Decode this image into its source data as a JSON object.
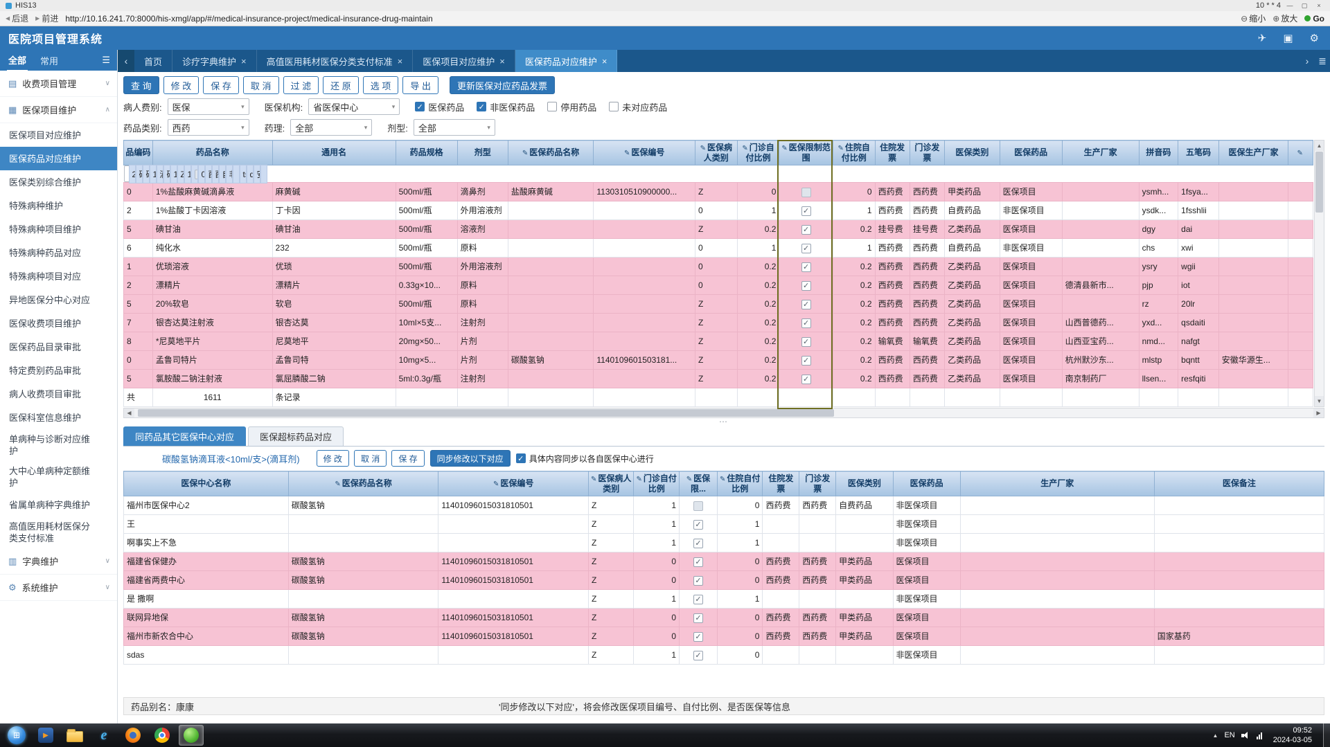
{
  "chrome": {
    "window_title": "HIS13",
    "window_meta": "10 * * 4",
    "back": "后退",
    "forward": "前进",
    "url": "http://10.16.241.70:8000/his-xmgl/app/#/medical-insurance-project/medical-insurance-drug-maintain",
    "zoom_out": "缩小",
    "zoom_in": "放大",
    "go": "Go"
  },
  "app": {
    "title": "医院项目管理系统",
    "header_icons": [
      "plane-icon",
      "window-copy-icon",
      "gear-icon"
    ]
  },
  "colors": {
    "accent": "#2e75b6",
    "pink_row": "#f7c3d4",
    "selected_row": "#cddcf2",
    "highlight_box": "#6f6f22"
  },
  "sidebar": {
    "tabs": [
      "全部",
      "常用"
    ],
    "menu": [
      {
        "type": "group",
        "label": "收费项目管理",
        "icon": "form-icon",
        "expanded": false
      },
      {
        "type": "group",
        "label": "医保项目维护",
        "icon": "board-icon",
        "expanded": true
      },
      {
        "type": "item",
        "label": "医保项目对应维护"
      },
      {
        "type": "item",
        "label": "医保药品对应维护",
        "active": true
      },
      {
        "type": "item",
        "label": "医保类别综合维护"
      },
      {
        "type": "item",
        "label": "特殊病种维护"
      },
      {
        "type": "item",
        "label": "特殊病种项目维护"
      },
      {
        "type": "item",
        "label": "特殊病种药品对应"
      },
      {
        "type": "item",
        "label": "特殊病种项目对应"
      },
      {
        "type": "item",
        "label": "异地医保分中心对应"
      },
      {
        "type": "item",
        "label": "医保收费项目维护"
      },
      {
        "type": "item",
        "label": "医保药品目录审批"
      },
      {
        "type": "item",
        "label": "特定费别药品审批"
      },
      {
        "type": "item",
        "label": "病人收费项目审批"
      },
      {
        "type": "item",
        "label": "医保科室信息维护"
      },
      {
        "type": "item",
        "label": "单病种与诊断对应维护"
      },
      {
        "type": "item",
        "label": "大中心单病种定额维护"
      },
      {
        "type": "item",
        "label": "省属单病种字典维护"
      },
      {
        "type": "item",
        "label": "高值医用耗材医保分类支付标准"
      },
      {
        "type": "group",
        "label": "字典维护",
        "icon": "dict-icon",
        "expanded": false
      },
      {
        "type": "group",
        "label": "系统维护",
        "icon": "gear-icon",
        "expanded": false
      }
    ]
  },
  "tabstrip": {
    "tabs": [
      {
        "label": "首页",
        "closable": false,
        "active": false
      },
      {
        "label": "诊疗字典维护",
        "closable": true,
        "active": false
      },
      {
        "label": "高值医用耗材医保分类支付标准",
        "closable": true,
        "active": false
      },
      {
        "label": "医保项目对应维护",
        "closable": true,
        "active": false
      },
      {
        "label": "医保药品对应维护",
        "closable": true,
        "active": true
      }
    ]
  },
  "toolbar": {
    "buttons": [
      "查 询",
      "修 改",
      "保 存",
      "取 消",
      "过 滤",
      "还 原",
      "选 项",
      "导 出"
    ],
    "update_button": "更新医保对应药品发票"
  },
  "filters": {
    "patient_fee_label": "病人费别:",
    "patient_fee_value": "医保",
    "org_label": "医保机构:",
    "org_value": "省医保中心",
    "checkboxes": [
      {
        "label": "医保药品",
        "checked": true
      },
      {
        "label": "非医保药品",
        "checked": true
      },
      {
        "label": "停用药品",
        "checked": false
      },
      {
        "label": "未对应药品",
        "checked": false
      }
    ],
    "drug_class_label": "药品类别:",
    "drug_class_value": "西药",
    "pharm_label": "药理:",
    "pharm_value": "全部",
    "dosage_label": "剂型:",
    "dosage_value": "全部"
  },
  "main_table": {
    "columns": [
      {
        "label": "品编码",
        "a": "l"
      },
      {
        "label": "药品名称",
        "a": "l"
      },
      {
        "label": "通用名",
        "a": "l"
      },
      {
        "label": "药品规格",
        "a": "l"
      },
      {
        "label": "剂型",
        "a": "l"
      },
      {
        "label": "医保药品名称",
        "e": true,
        "a": "l"
      },
      {
        "label": "医保编号",
        "e": true,
        "a": "l"
      },
      {
        "label": "医保病人类别",
        "e": true,
        "a": "l"
      },
      {
        "label": "门诊自付比例",
        "e": true,
        "a": "r"
      },
      {
        "label": "医保限制范围",
        "e": true,
        "a": "c",
        "hl": true
      },
      {
        "label": "住院自付比例",
        "e": true,
        "a": "r"
      },
      {
        "label": "住院发票",
        "a": "l"
      },
      {
        "label": "门诊发票",
        "a": "l"
      },
      {
        "label": "医保类别",
        "a": "l"
      },
      {
        "label": "医保药品",
        "a": "l"
      },
      {
        "label": "生产厂家",
        "a": "l"
      },
      {
        "label": "拼音码",
        "a": "l"
      },
      {
        "label": "五笔码",
        "a": "l"
      },
      {
        "label": "医保生产厂家",
        "a": "l"
      },
      {
        "label": "",
        "e": true,
        "a": "l"
      }
    ],
    "rows": [
      {
        "tone": "sel",
        "cells": [
          "20",
          "碳酸氢钠滴耳液",
          "碳酸氢钠",
          "10ml/支",
          "滴耳剂",
          "碳酸氢钠",
          "1140109601503181...",
          "Z",
          "1",
          "cb:dis",
          "0",
          "西药费",
          "西药费",
          "自费药品",
          "非医保项目",
          "",
          "tsqn...",
          "dsrqibi",
          "安徽华源生...",
          ""
        ]
      },
      {
        "tone": "pink",
        "cells": [
          "0",
          "1%盐酸麻黄碱滴鼻液",
          "麻黄碱",
          "500ml/瓶",
          "滴鼻剂",
          "盐酸麻黄碱",
          "1130310510900000...",
          "Z",
          "0",
          "cb:dis",
          "0",
          "西药费",
          "西药费",
          "甲类药品",
          "医保项目",
          "",
          "ysmh...",
          "1fsya...",
          "",
          ""
        ]
      },
      {
        "tone": "wht",
        "cells": [
          "2",
          "1%盐酸丁卡因溶液",
          "丁卡因",
          "500ml/瓶",
          "外用溶液剂",
          "",
          "",
          "0",
          "1",
          "cb:on",
          "1",
          "西药费",
          "西药费",
          "自费药品",
          "非医保项目",
          "",
          "ysdk...",
          "1fsshlii",
          "",
          ""
        ]
      },
      {
        "tone": "pink",
        "cells": [
          "5",
          "碘甘油",
          "碘甘油",
          "500ml/瓶",
          "溶液剂",
          "",
          "",
          "Z",
          "0.2",
          "cb:on",
          "0.2",
          "挂号费",
          "挂号费",
          "乙类药品",
          "医保项目",
          "",
          "dgy",
          "dai",
          "",
          ""
        ]
      },
      {
        "tone": "wht",
        "cells": [
          "6",
          "纯化水",
          "232",
          "500ml/瓶",
          "原料",
          "",
          "",
          "0",
          "1",
          "cb:on",
          "1",
          "西药费",
          "西药费",
          "自费药品",
          "非医保项目",
          "",
          "chs",
          "xwi",
          "",
          ""
        ]
      },
      {
        "tone": "pink",
        "cells": [
          "1",
          "优琐溶液",
          "优琐",
          "500ml/瓶",
          "外用溶液剂",
          "",
          "",
          "0",
          "0.2",
          "cb:on",
          "0.2",
          "西药费",
          "西药费",
          "乙类药品",
          "医保项目",
          "",
          "ysry",
          "wgii",
          "",
          ""
        ]
      },
      {
        "tone": "pink",
        "cells": [
          "2",
          "漂精片",
          "漂精片",
          "0.33g×10...",
          "原料",
          "",
          "",
          "0",
          "0.2",
          "cb:on",
          "0.2",
          "西药费",
          "西药费",
          "乙类药品",
          "医保项目",
          "德清县新市...",
          "pjp",
          "iot",
          "",
          ""
        ]
      },
      {
        "tone": "pink",
        "cells": [
          "5",
          "20%软皂",
          "软皂",
          "500ml/瓶",
          "原料",
          "",
          "",
          "Z",
          "0.2",
          "cb:on",
          "0.2",
          "西药费",
          "西药费",
          "乙类药品",
          "医保项目",
          "",
          "rz",
          "20lr",
          "",
          ""
        ]
      },
      {
        "tone": "pink",
        "cells": [
          "7",
          "银杏达莫注射液",
          "银杏达莫",
          "10ml×5支...",
          "注射剂",
          "",
          "",
          "Z",
          "0.2",
          "cb:on",
          "0.2",
          "西药费",
          "西药费",
          "乙类药品",
          "医保项目",
          "山西普德药...",
          "yxd...",
          "qsdaiti",
          "",
          ""
        ]
      },
      {
        "tone": "pink",
        "cells": [
          "8",
          "*尼莫地平片",
          "尼莫地平",
          "20mg×50...",
          "片剂",
          "",
          "",
          "Z",
          "0.2",
          "cb:on",
          "0.2",
          "输氧费",
          "输氧费",
          "乙类药品",
          "医保项目",
          "山西亚宝药...",
          "nmd...",
          "nafgt",
          "",
          ""
        ]
      },
      {
        "tone": "pink",
        "cells": [
          "0",
          "孟鲁司特片",
          "孟鲁司特",
          "10mg×5...",
          "片剂",
          "碳酸氢钠",
          "1140109601503181...",
          "Z",
          "0.2",
          "cb:on",
          "0.2",
          "西药费",
          "西药费",
          "乙类药品",
          "医保项目",
          "杭州默沙东...",
          "mlstp",
          "bqntt",
          "安徽华源生...",
          ""
        ]
      },
      {
        "tone": "pink",
        "cells": [
          "5",
          "氯胺酸二钠注射液",
          "氯屈膦酸二钠",
          "5ml:0.3g/瓶",
          "注射剂",
          "",
          "",
          "Z",
          "0.2",
          "cb:on",
          "0.2",
          "西药费",
          "西药费",
          "乙类药品",
          "医保项目",
          "南京制药厂",
          "llsen...",
          "resfqiti",
          "",
          ""
        ]
      }
    ],
    "summary": [
      "共",
      "1611",
      "条记录"
    ]
  },
  "bottom_panel": {
    "tabs": [
      {
        "label": "同药品其它医保中心对应",
        "active": true
      },
      {
        "label": "医保超标药品对应",
        "active": false
      }
    ],
    "drug_link": "碳酸氢钠滴耳液<10ml/支>(滴耳剂)",
    "buttons": [
      "修 改",
      "取 消",
      "保 存"
    ],
    "sync_button": "同步修改以下对应",
    "sync_checkbox": {
      "label": "具体内容同步以各自医保中心进行",
      "checked": true
    },
    "columns": [
      {
        "label": "医保中心名称",
        "a": "l"
      },
      {
        "label": "医保药品名称",
        "e": true,
        "a": "l"
      },
      {
        "label": "医保编号",
        "e": true,
        "a": "l"
      },
      {
        "label": "医保病人类别",
        "e": true,
        "a": "l"
      },
      {
        "label": "门诊自付比例",
        "e": true,
        "a": "r"
      },
      {
        "label": "医保限...",
        "e": true,
        "a": "c"
      },
      {
        "label": "住院自付比例",
        "e": true,
        "a": "r"
      },
      {
        "label": "住院发票",
        "a": "l"
      },
      {
        "label": "门诊发票",
        "a": "l"
      },
      {
        "label": "医保类别",
        "a": "l"
      },
      {
        "label": "医保药品",
        "a": "l"
      },
      {
        "label": "生产厂家",
        "a": "l"
      },
      {
        "label": "医保备注",
        "a": "l"
      }
    ],
    "rows": [
      {
        "tone": "wht",
        "cells": [
          "福州市医保中心2",
          "碳酸氢钠",
          "11401096015031810501",
          "Z",
          "1",
          "cb:dis",
          "0",
          "西药费",
          "西药费",
          "自费药品",
          "非医保项目",
          "",
          ""
        ]
      },
      {
        "tone": "wht",
        "cells": [
          "王",
          "",
          "",
          "Z",
          "1",
          "cb:on",
          "1",
          "",
          "",
          "",
          "非医保项目",
          "",
          ""
        ]
      },
      {
        "tone": "wht",
        "cells": [
          "啊事实上不急",
          "",
          "",
          "Z",
          "1",
          "cb:on",
          "1",
          "",
          "",
          "",
          "非医保项目",
          "",
          ""
        ]
      },
      {
        "tone": "pink",
        "cells": [
          "福建省保健办",
          "碳酸氢钠",
          "11401096015031810501",
          "Z",
          "0",
          "cb:on",
          "0",
          "西药费",
          "西药费",
          "甲类药品",
          "医保项目",
          "",
          ""
        ]
      },
      {
        "tone": "pink",
        "cells": [
          "福建省两费中心",
          "碳酸氢钠",
          "11401096015031810501",
          "Z",
          "0",
          "cb:on",
          "0",
          "西药费",
          "西药费",
          "甲类药品",
          "医保项目",
          "",
          ""
        ]
      },
      {
        "tone": "wht",
        "cells": [
          "是 撒啊",
          "",
          "",
          "Z",
          "1",
          "cb:on",
          "1",
          "",
          "",
          "",
          "非医保项目",
          "",
          ""
        ]
      },
      {
        "tone": "pink",
        "cells": [
          "联网异地保",
          "碳酸氢钠",
          "11401096015031810501",
          "Z",
          "0",
          "cb:on",
          "0",
          "西药费",
          "西药费",
          "甲类药品",
          "医保项目",
          "",
          ""
        ]
      },
      {
        "tone": "pink",
        "cells": [
          "福州市新农合中心",
          "碳酸氢钠",
          "11401096015031810501",
          "Z",
          "0",
          "cb:on",
          "0",
          "西药费",
          "西药费",
          "甲类药品",
          "医保项目",
          "",
          "国家基药"
        ]
      },
      {
        "tone": "wht",
        "cells": [
          "sdas",
          "",
          "",
          "Z",
          "1",
          "cb:on",
          "0",
          "",
          "",
          "",
          "非医保项目",
          "",
          ""
        ]
      }
    ]
  },
  "status": {
    "drug_alias": "药品别名：康康",
    "sync_hint": "'同步修改以下对应'，将会修改医保项目编号、自付比例、是否医保等信息"
  },
  "taskbar": {
    "lang": "EN",
    "time": "09:52",
    "date": "2024-03-05",
    "icons": [
      {
        "name": "start-button"
      },
      {
        "name": "media-player-icon"
      },
      {
        "name": "folder-icon"
      },
      {
        "name": "ie-icon"
      },
      {
        "name": "firefox-icon"
      },
      {
        "name": "chrome-icon"
      },
      {
        "name": "his-app-icon",
        "active": true
      }
    ]
  }
}
